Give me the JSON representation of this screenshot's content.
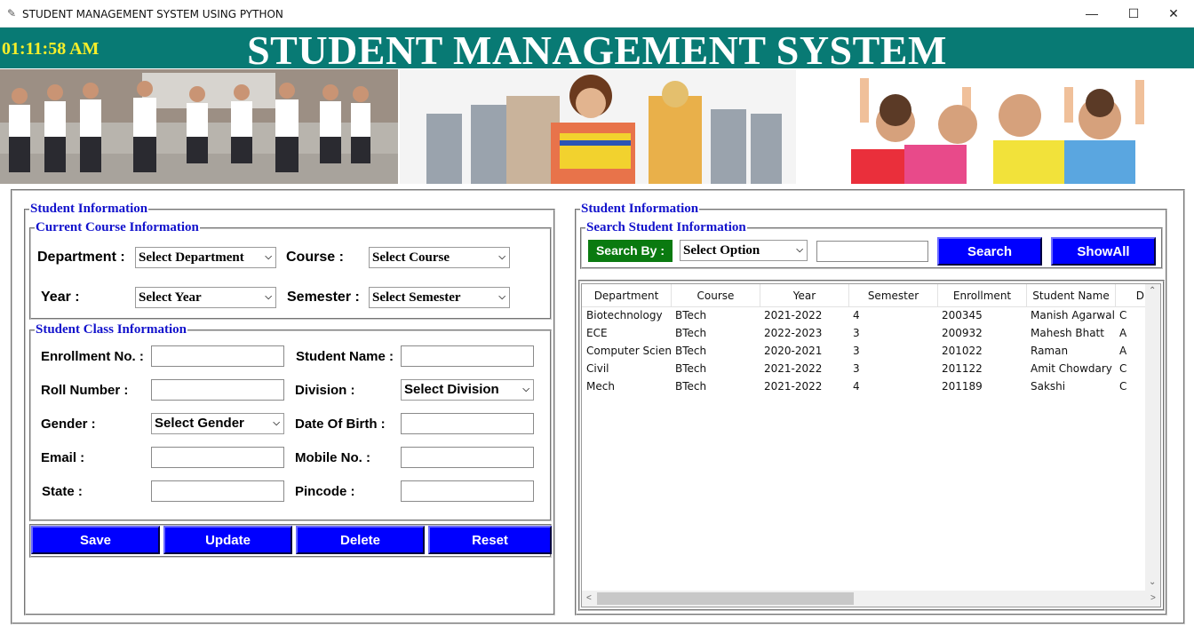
{
  "window": {
    "title": "STUDENT MANAGEMENT SYSTEM USING PYTHON",
    "minimize": "—",
    "maximize": "☐",
    "close": "✕"
  },
  "header": {
    "clock": "01:11:58 AM",
    "title": "STUDENT MANAGEMENT SYSTEM"
  },
  "left": {
    "frame_title": "Student Information",
    "course": {
      "title": "Current Course Information",
      "department_label": "Department :",
      "department_value": "Select Department",
      "course_label": "Course :",
      "course_value": "Select Course",
      "year_label": "Year :",
      "year_value": "Select Year",
      "semester_label": "Semester :",
      "semester_value": "Select Semester"
    },
    "klass": {
      "title": "Student Class Information",
      "enrollment_label": "Enrollment No. :",
      "student_name_label": "Student Name :",
      "roll_label": "Roll Number :",
      "division_label": "Division :",
      "division_value": "Select Division",
      "gender_label": "Gender :",
      "gender_value": "Select Gender",
      "dob_label": "Date Of Birth :",
      "email_label": "Email :",
      "mobile_label": "Mobile No. :",
      "state_label": "State :",
      "pincode_label": "Pincode :"
    },
    "buttons": {
      "save": "Save",
      "update": "Update",
      "delete": "Delete",
      "reset": "Reset"
    }
  },
  "right": {
    "frame_title": "Student Information",
    "search": {
      "title": "Search Student Information",
      "search_by": "Search By :",
      "option": "Select Option",
      "search_btn": "Search",
      "showall_btn": "ShowAll"
    },
    "table": {
      "columns": [
        "Department",
        "Course",
        "Year",
        "Semester",
        "Enrollment",
        "Student Name",
        "D"
      ],
      "rows": [
        [
          "Biotechnology",
          "BTech",
          "2021-2022",
          "4",
          "200345",
          "Manish Agarwal",
          "C"
        ],
        [
          "ECE",
          "BTech",
          "2022-2023",
          "3",
          "200932",
          "Mahesh Bhatt",
          "A"
        ],
        [
          "Computer Scienc",
          "BTech",
          "2020-2021",
          "3",
          "201022",
          "Raman",
          "A"
        ],
        [
          "Civil",
          "BTech",
          "2021-2022",
          "3",
          "201122",
          "Amit Chowdary",
          "C"
        ],
        [
          "Mech",
          "BTech",
          "2021-2022",
          "4",
          "201189",
          "Sakshi",
          "C"
        ]
      ]
    }
  }
}
